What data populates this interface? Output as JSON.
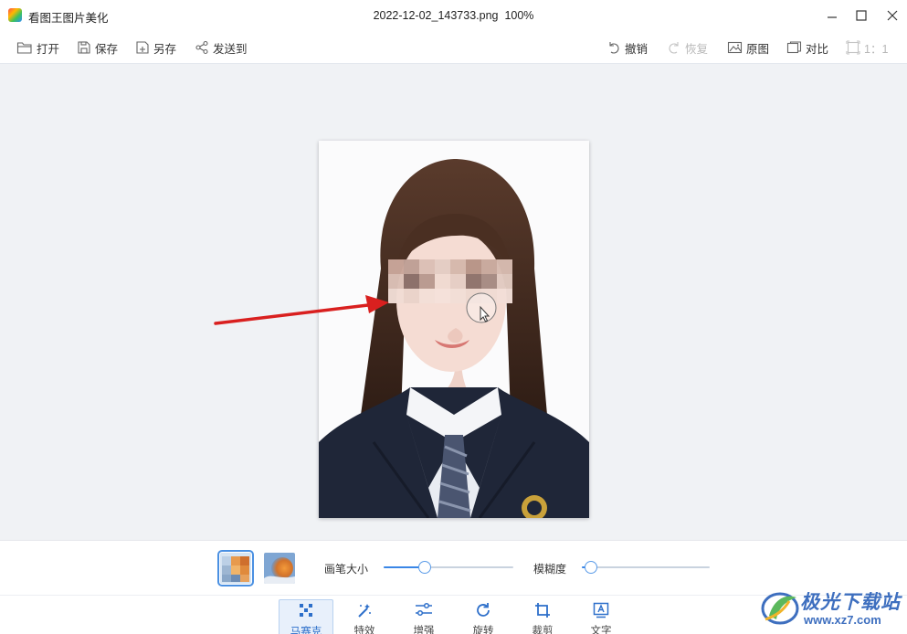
{
  "app": {
    "name": "看图王图片美化"
  },
  "document": {
    "filename": "2022-12-02_143733.png",
    "zoom": "100%"
  },
  "window_controls": {
    "minimize_icon": "minimize-icon",
    "maximize_icon": "maximize-icon",
    "close_icon": "close-icon"
  },
  "toolbar": {
    "open": "打开",
    "save": "保存",
    "save_as": "另存",
    "send_to": "发送到",
    "undo": "撤销",
    "redo": "恢复",
    "original": "原图",
    "compare": "对比",
    "ratio": "1：1"
  },
  "controls": {
    "brush_size_label": "画笔大小",
    "brush_size_value": 0.32,
    "blur_label": "模糊度",
    "blur_value": 0.07
  },
  "tools": [
    {
      "label": "马赛克",
      "icon": "mosaic-icon",
      "active": true
    },
    {
      "label": "特效",
      "icon": "magic-wand-icon",
      "active": false
    },
    {
      "label": "增强",
      "icon": "sliders-icon",
      "active": false
    },
    {
      "label": "旋转",
      "icon": "rotate-icon",
      "active": false
    },
    {
      "label": "裁剪",
      "icon": "crop-icon",
      "active": false
    },
    {
      "label": "文字",
      "icon": "text-icon",
      "active": false
    }
  ],
  "watermark": {
    "text": "极光下载站",
    "url": "www.xz7.com"
  },
  "colors": {
    "accent": "#3a86e6",
    "arrow": "#d9201f",
    "canvas_bg": "#f0f2f5"
  }
}
